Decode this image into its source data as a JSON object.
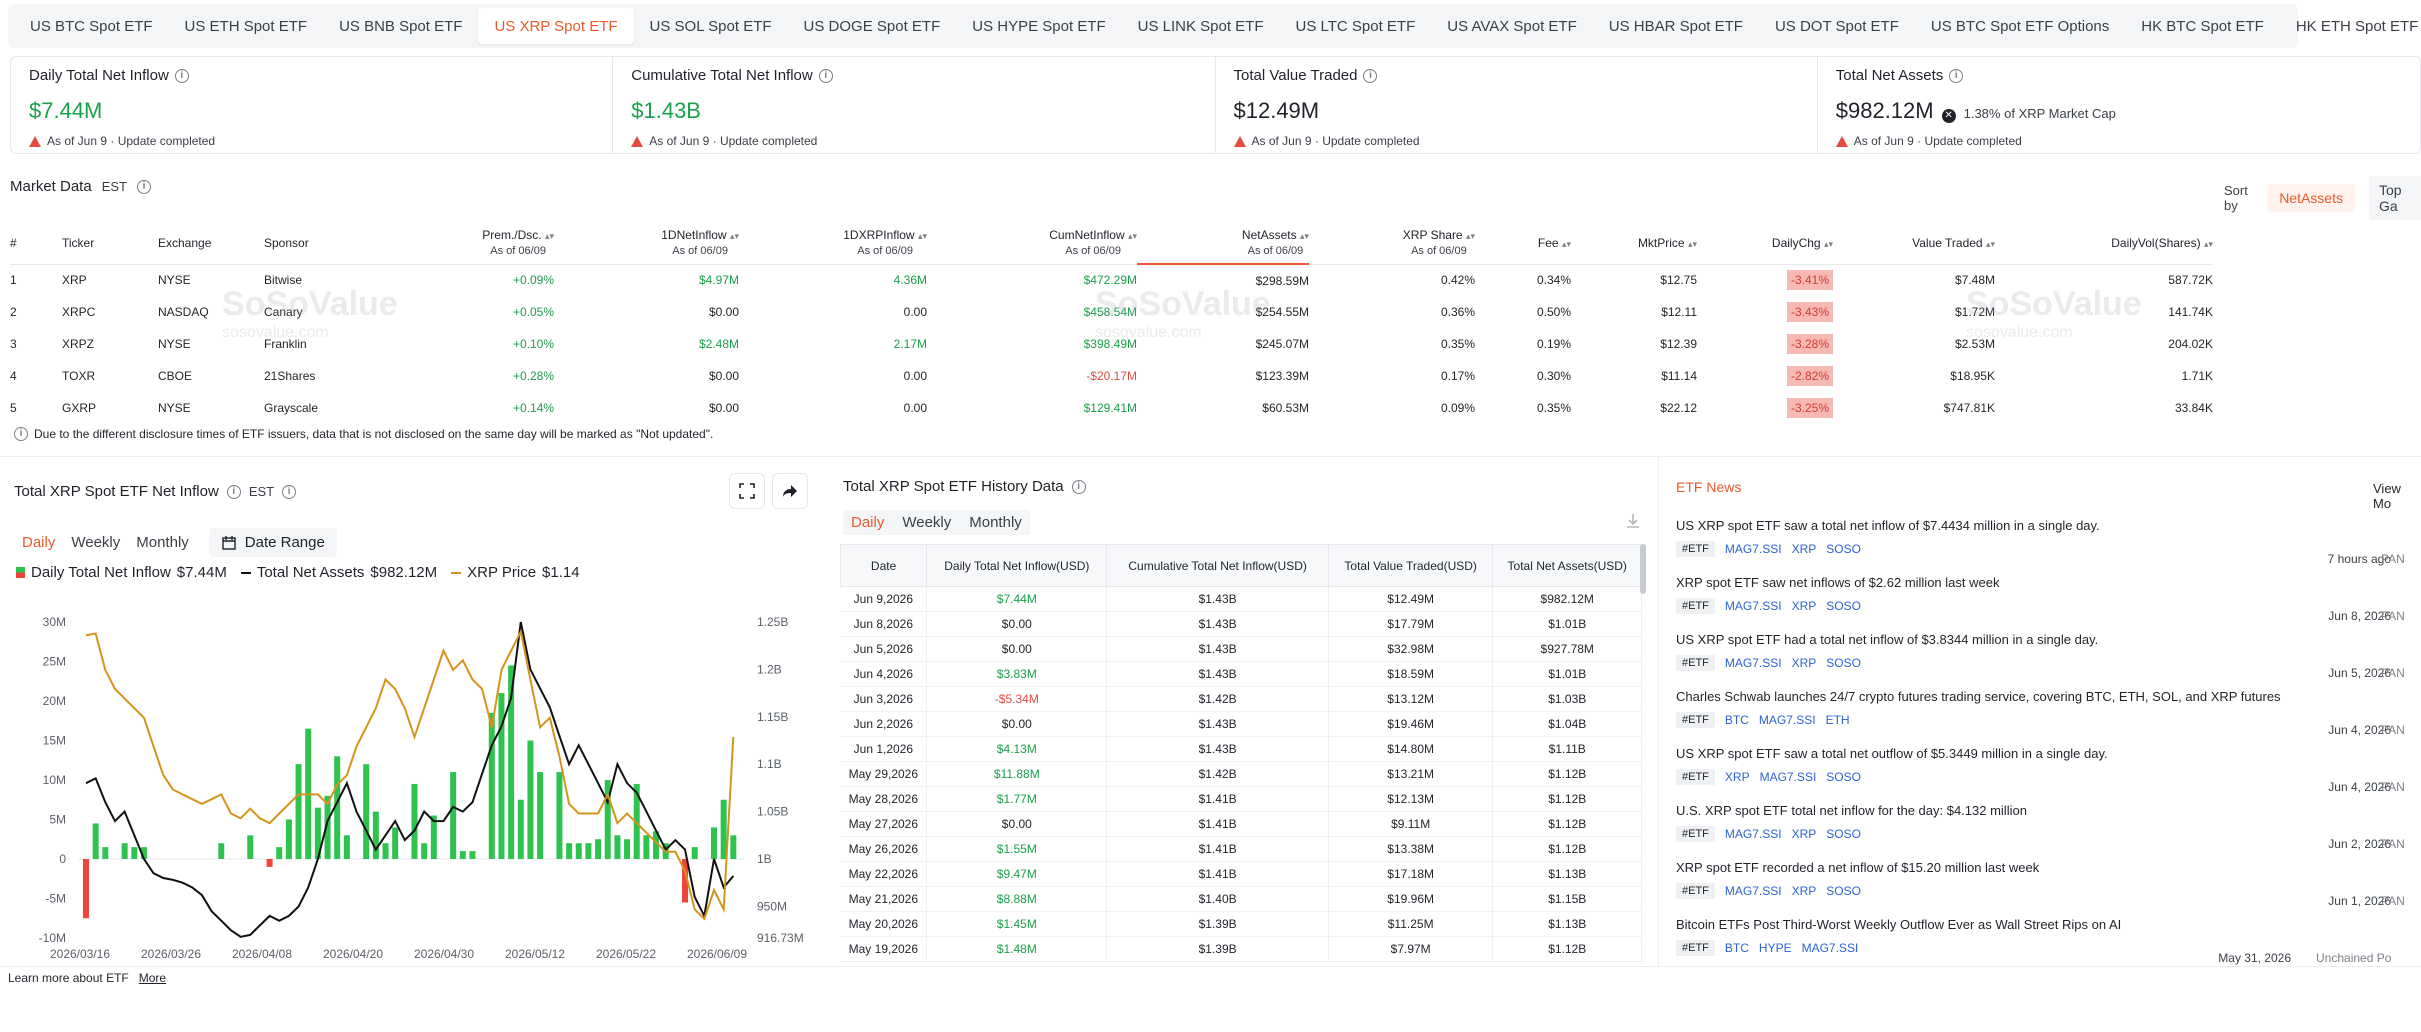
{
  "tabs": [
    "US BTC Spot ETF",
    "US ETH Spot ETF",
    "US BNB Spot ETF",
    "US XRP Spot ETF",
    "US SOL Spot ETF",
    "US DOGE Spot ETF",
    "US HYPE Spot ETF",
    "US LINK Spot ETF",
    "US LTC Spot ETF",
    "US AVAX Spot ETF",
    "US HBAR Spot ETF",
    "US DOT Spot ETF",
    "US BTC Spot ETF Options",
    "HK BTC Spot ETF",
    "HK ETH Spot ETF"
  ],
  "active_tab_index": 3,
  "more_label": "More",
  "cards": [
    {
      "title": "Daily Total Net Inflow",
      "value": "$7.44M",
      "note": "As of Jun 9 · Update completed"
    },
    {
      "title": "Cumulative Total Net Inflow",
      "value": "$1.43B",
      "note": "As of Jun 9 · Update completed"
    },
    {
      "title": "Total Value Traded",
      "value": "$12.49M",
      "note": "As of Jun 9 · Update completed"
    },
    {
      "title": "Total Net Assets",
      "value": "$982.12M",
      "extra_pct": "1.38%",
      "extra_label": "of XRP Market Cap",
      "note": "As of Jun 9 · Update completed"
    }
  ],
  "market": {
    "title": "Market Data",
    "tz": "EST",
    "sort_label": "Sort by",
    "sort_active": "NetAssets",
    "sort_next": "Top Ga",
    "headers": {
      "num": "#",
      "ticker": "Ticker",
      "exchange": "Exchange",
      "sponsor": "Sponsor",
      "prem": "Prem./Dsc.",
      "inflow": "1DNetInflow",
      "xrpinflow": "1DXRPInflow",
      "cum": "CumNetInflow",
      "assets": "NetAssets",
      "share": "XRP Share",
      "fee": "Fee",
      "price": "MktPrice",
      "chg": "DailyChg",
      "traded": "Value Traded",
      "vol": "DailyVol(Shares)",
      "asof": "As of 06/09"
    },
    "rows": [
      {
        "n": "1",
        "ticker": "XRP",
        "exchange": "NYSE",
        "sponsor": "Bitwise",
        "prem": "+0.09%",
        "inflow": "$4.97M",
        "xrp": "4.36M",
        "cum": "$472.29M",
        "assets": "$298.59M",
        "share": "0.42%",
        "fee": "0.34%",
        "price": "$12.75",
        "chg": "-3.41%",
        "traded": "$7.48M",
        "vol": "587.72K"
      },
      {
        "n": "2",
        "ticker": "XRPC",
        "exchange": "NASDAQ",
        "sponsor": "Canary",
        "prem": "+0.05%",
        "inflow": "$0.00",
        "xrp": "0.00",
        "cum": "$458.54M",
        "assets": "$254.55M",
        "share": "0.36%",
        "fee": "0.50%",
        "price": "$12.11",
        "chg": "-3.43%",
        "traded": "$1.72M",
        "vol": "141.74K"
      },
      {
        "n": "3",
        "ticker": "XRPZ",
        "exchange": "NYSE",
        "sponsor": "Franklin",
        "prem": "+0.10%",
        "inflow": "$2.48M",
        "xrp": "2.17M",
        "cum": "$398.49M",
        "assets": "$245.07M",
        "share": "0.35%",
        "fee": "0.19%",
        "price": "$12.39",
        "chg": "-3.28%",
        "traded": "$2.53M",
        "vol": "204.02K"
      },
      {
        "n": "4",
        "ticker": "TOXR",
        "exchange": "CBOE",
        "sponsor": "21Shares",
        "prem": "+0.28%",
        "inflow": "$0.00",
        "xrp": "0.00",
        "cum": "-$20.17M",
        "assets": "$123.39M",
        "share": "0.17%",
        "fee": "0.30%",
        "price": "$11.14",
        "chg": "-2.82%",
        "traded": "$18.95K",
        "vol": "1.71K"
      },
      {
        "n": "5",
        "ticker": "GXRP",
        "exchange": "NYSE",
        "sponsor": "Grayscale",
        "prem": "+0.14%",
        "inflow": "$0.00",
        "xrp": "0.00",
        "cum": "$129.41M",
        "assets": "$60.53M",
        "share": "0.09%",
        "fee": "0.35%",
        "price": "$22.12",
        "chg": "-3.25%",
        "traded": "$747.81K",
        "vol": "33.84K"
      }
    ],
    "disclaimer": "Due to the different disclosure times of ETF issuers, data that is not disclosed on the same day will be marked as \"Not updated\"."
  },
  "watermark": {
    "brand": "SoSoValue",
    "site": "sosovalue.com"
  },
  "chart_panel": {
    "title": "Total XRP Spot ETF Net Inflow",
    "tz": "EST",
    "periods": [
      "Daily",
      "Weekly",
      "Monthly"
    ],
    "date_range": "Date Range",
    "legend": [
      {
        "label": "Daily Total Net Inflow",
        "value": "$7.44M"
      },
      {
        "label": "Total Net Assets",
        "value": "$982.12M"
      },
      {
        "label": "XRP Price",
        "value": "$1.14"
      }
    ]
  },
  "chart_data": {
    "type": "bar",
    "x_ticks": [
      "2026/03/16",
      "2026/03/26",
      "2026/04/08",
      "2026/04/20",
      "2026/04/30",
      "2026/05/12",
      "2026/05/22",
      "2026/06/09"
    ],
    "y_left_ticks": [
      "30M",
      "25M",
      "20M",
      "15M",
      "10M",
      "5M",
      "0",
      "-5M",
      "-10M"
    ],
    "y_right_ticks": [
      "1.25B",
      "1.2B",
      "1.15B",
      "1.1B",
      "1.05B",
      "1B",
      "950M",
      "916.73M"
    ],
    "ylim_left": [
      -10,
      30
    ],
    "ylim_right": [
      916.73,
      1250
    ],
    "colors": {
      "inflow_pos": "#2ec24f",
      "inflow_neg": "#f0433a",
      "assets": "#111111",
      "price": "#d4941c"
    },
    "series": [
      {
        "name": "Daily Total Net Inflow",
        "unit": "M",
        "values": [
          -7.5,
          4.5,
          1.5,
          0,
          2,
          1.5,
          1.5,
          0,
          0,
          0,
          0,
          0,
          0,
          0,
          2,
          0,
          0,
          3,
          0,
          -1,
          1.5,
          5,
          12,
          16.5,
          6.5,
          8,
          13,
          3,
          0,
          12,
          6,
          2,
          4,
          0,
          9.5,
          2,
          5.5,
          0,
          11,
          1,
          1,
          0,
          18.5,
          21,
          24.5,
          7.5,
          15,
          11,
          0,
          11,
          2,
          2,
          2,
          2.5,
          10,
          3,
          2.5,
          9.5,
          3,
          3.5,
          2,
          0,
          -5.5,
          1.5,
          0,
          4,
          7.5,
          3
        ]
      },
      {
        "name": "Total Net Assets",
        "unit": "M",
        "values": [
          1080,
          1085,
          1060,
          1040,
          1050,
          1025,
          1000,
          985,
          980,
          978,
          975,
          970,
          962,
          945,
          935,
          925,
          918,
          920,
          930,
          940,
          935,
          940,
          950,
          970,
          1000,
          1040,
          1060,
          1080,
          1050,
          1030,
          1010,
          1025,
          1040,
          1020,
          1030,
          1050,
          1040,
          1040,
          1055,
          1050,
          1060,
          1090,
          1120,
          1140,
          1170,
          1250,
          1200,
          1180,
          1160,
          1130,
          1100,
          1120,
          1100,
          1080,
          1060,
          1100,
          1080,
          1070,
          1050,
          1030,
          1010,
          1020,
          1010,
          960,
          940,
          1000,
          970,
          982.12
        ]
      },
      {
        "name": "XRP Price",
        "unit": "USD",
        "values": [
          1.246,
          1.248,
          1.21,
          1.19,
          1.18,
          1.17,
          1.16,
          1.13,
          1.1,
          1.085,
          1.08,
          1.075,
          1.07,
          1.075,
          1.08,
          1.06,
          1.055,
          1.065,
          1.055,
          1.05,
          1.06,
          1.07,
          1.08,
          1.08,
          1.08,
          1.07,
          1.09,
          1.1,
          1.13,
          1.15,
          1.17,
          1.2,
          1.19,
          1.17,
          1.14,
          1.17,
          1.2,
          1.23,
          1.21,
          1.22,
          1.2,
          1.19,
          1.15,
          1.21,
          1.23,
          1.25,
          1.2,
          1.15,
          1.16,
          1.12,
          1.07,
          1.06,
          1.06,
          1.06,
          1.08,
          1.05,
          1.06,
          1.05,
          1.04,
          1.03,
          1.02,
          1.02,
          1.0,
          0.96,
          0.95,
          0.98,
          0.96,
          1.14
        ]
      }
    ]
  },
  "history": {
    "title": "Total XRP Spot ETF History Data",
    "periods": [
      "Daily",
      "Weekly",
      "Monthly"
    ],
    "headers": [
      "Date",
      "Daily Total Net Inflow(USD)",
      "Cumulative Total Net Inflow(USD)",
      "Total Value Traded(USD)",
      "Total Net Assets(USD)"
    ],
    "rows": [
      [
        "Jun 9,2026",
        "$7.44M",
        "$1.43B",
        "$12.49M",
        "$982.12M"
      ],
      [
        "Jun 8,2026",
        "$0.00",
        "$1.43B",
        "$17.79M",
        "$1.01B"
      ],
      [
        "Jun 5,2026",
        "$0.00",
        "$1.43B",
        "$32.98M",
        "$927.78M"
      ],
      [
        "Jun 4,2026",
        "$3.83M",
        "$1.43B",
        "$18.59M",
        "$1.01B"
      ],
      [
        "Jun 3,2026",
        "-$5.34M",
        "$1.42B",
        "$13.12M",
        "$1.03B"
      ],
      [
        "Jun 2,2026",
        "$0.00",
        "$1.43B",
        "$19.46M",
        "$1.04B"
      ],
      [
        "Jun 1,2026",
        "$4.13M",
        "$1.43B",
        "$14.80M",
        "$1.11B"
      ],
      [
        "May 29,2026",
        "$11.88M",
        "$1.42B",
        "$13.21M",
        "$1.12B"
      ],
      [
        "May 28,2026",
        "$1.77M",
        "$1.41B",
        "$12.13M",
        "$1.12B"
      ],
      [
        "May 27,2026",
        "$0.00",
        "$1.41B",
        "$9.11M",
        "$1.12B"
      ],
      [
        "May 26,2026",
        "$1.55M",
        "$1.41B",
        "$13.38M",
        "$1.12B"
      ],
      [
        "May 22,2026",
        "$9.47M",
        "$1.41B",
        "$17.18M",
        "$1.13B"
      ],
      [
        "May 21,2026",
        "$8.88M",
        "$1.40B",
        "$19.96M",
        "$1.15B"
      ],
      [
        "May 20,2026",
        "$1.45M",
        "$1.39B",
        "$11.25M",
        "$1.13B"
      ],
      [
        "May 19,2026",
        "$1.48M",
        "$1.39B",
        "$7.97M",
        "$1.12B"
      ]
    ]
  },
  "news": {
    "title": "ETF News",
    "view_more": "View Mo",
    "items": [
      {
        "title": "US XRP spot ETF saw a total net inflow of $7.4434 million in a single day.",
        "tag": "#ETF",
        "links": [
          "MAG7.SSI",
          "XRP",
          "SOSO"
        ],
        "date": "7 hours ago",
        "source": "PAN"
      },
      {
        "title": "XRP spot ETF saw net inflows of $2.62 million last week",
        "tag": "#ETF",
        "links": [
          "MAG7.SSI",
          "XRP",
          "SOSO"
        ],
        "date": "Jun 8, 2026",
        "source": "PAN"
      },
      {
        "title": "US XRP spot ETF had a total net inflow of $3.8344 million in a single day.",
        "tag": "#ETF",
        "links": [
          "MAG7.SSI",
          "XRP",
          "SOSO"
        ],
        "date": "Jun 5, 2026",
        "source": "PAN"
      },
      {
        "title": "Charles Schwab launches 24/7 crypto futures trading service, covering BTC, ETH, SOL, and XRP futures",
        "tag": "#ETF",
        "links": [
          "BTC",
          "MAG7.SSI",
          "ETH"
        ],
        "date": "Jun 4, 2026",
        "source": "PAN"
      },
      {
        "title": "US XRP spot ETF saw a total net outflow of $5.3449 million in a single day.",
        "tag": "#ETF",
        "links": [
          "XRP",
          "MAG7.SSI",
          "SOSO"
        ],
        "date": "Jun 4, 2026",
        "source": "PAN"
      },
      {
        "title": "U.S. XRP spot ETF total net inflow for the day: $4.132 million",
        "tag": "#ETF",
        "links": [
          "MAG7.SSI",
          "XRP",
          "SOSO"
        ],
        "date": "Jun 2, 2026",
        "source": "PAN"
      },
      {
        "title": "XRP spot ETF recorded a net inflow of $15.20 million last week",
        "tag": "#ETF",
        "links": [
          "MAG7.SSI",
          "XRP",
          "SOSO"
        ],
        "date": "Jun 1, 2026",
        "source": "PAN"
      },
      {
        "title": "Bitcoin ETFs Post Third-Worst Weekly Outflow Ever as Wall Street Rips on AI",
        "tag": "#ETF",
        "links": [
          "BTC",
          "HYPE",
          "MAG7.SSI"
        ],
        "date": "May 31, 2026",
        "source": "Unchained Po"
      }
    ]
  },
  "footer": {
    "text": "Learn more about ETF",
    "link": "More"
  }
}
